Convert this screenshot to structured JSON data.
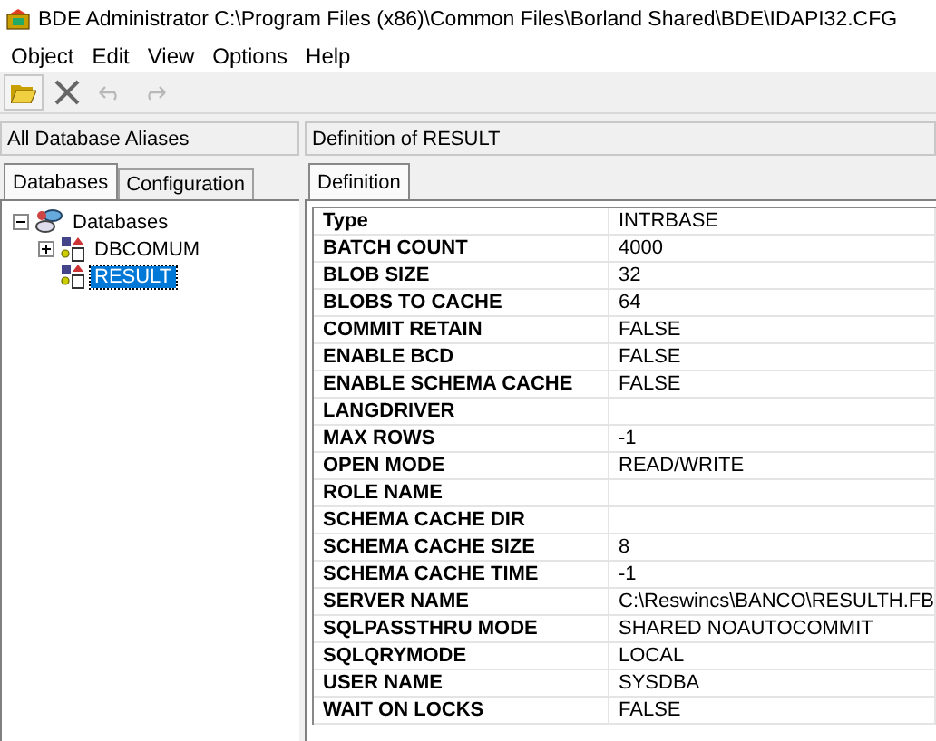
{
  "window": {
    "title": "BDE Administrator  C:\\Program Files (x86)\\Common Files\\Borland Shared\\BDE\\IDAPI32.CFG"
  },
  "menu": [
    "Object",
    "Edit",
    "View",
    "Options",
    "Help"
  ],
  "toolbar": [
    {
      "kind": "open",
      "disabled": false
    },
    {
      "kind": "delete",
      "disabled": false
    },
    {
      "kind": "undo",
      "disabled": true
    },
    {
      "kind": "redo",
      "disabled": true
    }
  ],
  "left_panel": {
    "header": "All Database Aliases",
    "tabs": [
      {
        "label": "Databases",
        "selected": true
      },
      {
        "label": "Configuration",
        "selected": false
      }
    ],
    "tree": [
      {
        "label": "Databases",
        "kind": "root",
        "expanded": true,
        "selected": false,
        "children": [
          {
            "label": "DBCOMUM",
            "kind": "alias",
            "expanded": false,
            "selected": false
          },
          {
            "label": "RESULT",
            "kind": "alias",
            "selected": true
          }
        ]
      }
    ]
  },
  "right_panel": {
    "header": "Definition of RESULT",
    "tabs": [
      {
        "label": "Definition",
        "selected": true
      }
    ],
    "rows": [
      {
        "name": "Type",
        "value": "INTRBASE"
      },
      {
        "name": "BATCH COUNT",
        "value": "4000"
      },
      {
        "name": "BLOB SIZE",
        "value": "32"
      },
      {
        "name": "BLOBS TO CACHE",
        "value": "64"
      },
      {
        "name": "COMMIT RETAIN",
        "value": "FALSE"
      },
      {
        "name": "ENABLE BCD",
        "value": "FALSE"
      },
      {
        "name": "ENABLE SCHEMA CACHE",
        "value": "FALSE"
      },
      {
        "name": "LANGDRIVER"
      },
      {
        "name": "MAX ROWS",
        "value": "-1"
      },
      {
        "name": "OPEN MODE",
        "value": "READ/WRITE"
      },
      {
        "name": "ROLE NAME"
      },
      {
        "name": "SCHEMA CACHE DIR"
      },
      {
        "name": "SCHEMA CACHE SIZE",
        "value": "8"
      },
      {
        "name": "SCHEMA CACHE TIME",
        "value": "-1"
      },
      {
        "name": "SERVER NAME",
        "value": "C:\\Reswincs\\BANCO\\RESULTH.FB"
      },
      {
        "name": "SQLPASSTHRU MODE",
        "value": "SHARED NOAUTOCOMMIT"
      },
      {
        "name": "SQLQRYMODE",
        "value": "LOCAL"
      },
      {
        "name": "USER NAME",
        "value": "SYSDBA"
      },
      {
        "name": "WAIT ON LOCKS",
        "value": "FALSE"
      }
    ]
  }
}
